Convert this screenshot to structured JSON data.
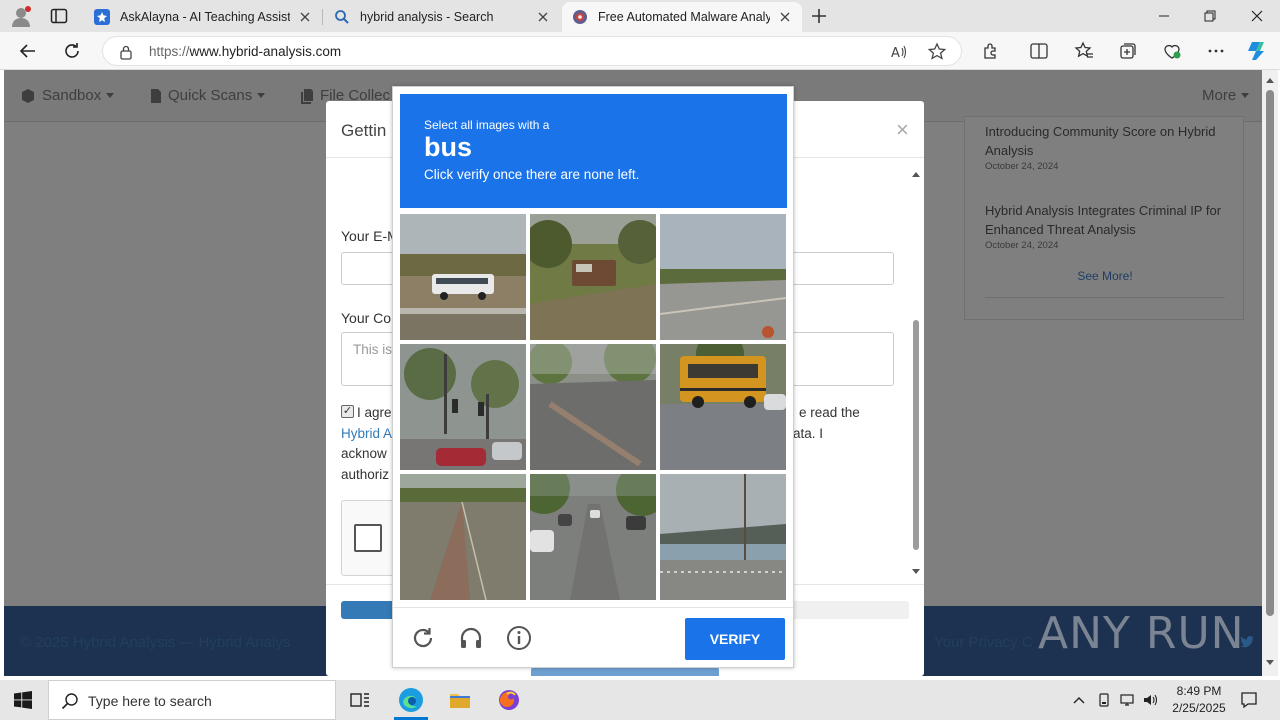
{
  "browser": {
    "tabs": [
      {
        "title": "AskAlayna - AI Teaching Assistant",
        "active": false
      },
      {
        "title": "hybrid analysis - Search",
        "active": false
      },
      {
        "title": "Free Automated Malware Analysis",
        "active": true
      }
    ],
    "url_prefix": "https://",
    "url_host": "www.hybrid-analysis.com"
  },
  "site": {
    "nav": [
      {
        "label": "Sandbox"
      },
      {
        "label": "Quick Scans"
      },
      {
        "label": "File Collec"
      }
    ],
    "nav_more": "More",
    "news": [
      {
        "title": "Introducing Community Score on Hybrid Analysis",
        "date": "October 24, 2024"
      },
      {
        "title": "Hybrid Analysis Integrates Criminal IP for Enhanced Threat Analysis",
        "date": "October 24, 2024"
      }
    ],
    "see_more": "See More!",
    "footer_left": "© 2025 Hybrid Analysis — Hybrid Analys",
    "footer_right": "Your Privacy C"
  },
  "modal": {
    "title": "Gettin",
    "email_label": "Your E-M",
    "comment_label": "Your Co",
    "comment_placeholder": "This is",
    "agree_line1_left": "I agre",
    "agree_line1_right": "e read the",
    "agree_link": "Hybrid A",
    "agree_line2_right": "ata. I",
    "agree_line3": "acknow",
    "agree_line4": "authoriz",
    "progress": 0.1,
    "agree_checked": true
  },
  "captcha": {
    "instruction_small": "Select all images with a",
    "target": "bus",
    "instruction_sub": "Click verify once there are none left.",
    "verify_label": "VERIFY",
    "icons": [
      "reload-icon",
      "audio-icon",
      "info-icon"
    ]
  },
  "watermark": "ANY RUN",
  "taskbar": {
    "search_placeholder": "Type here to search",
    "time": "8:49 PM",
    "date": "2/25/2025"
  },
  "colors": {
    "captcha_blue": "#1a73e8",
    "footer_navy": "#1c3250",
    "link_blue": "#337ab7"
  }
}
